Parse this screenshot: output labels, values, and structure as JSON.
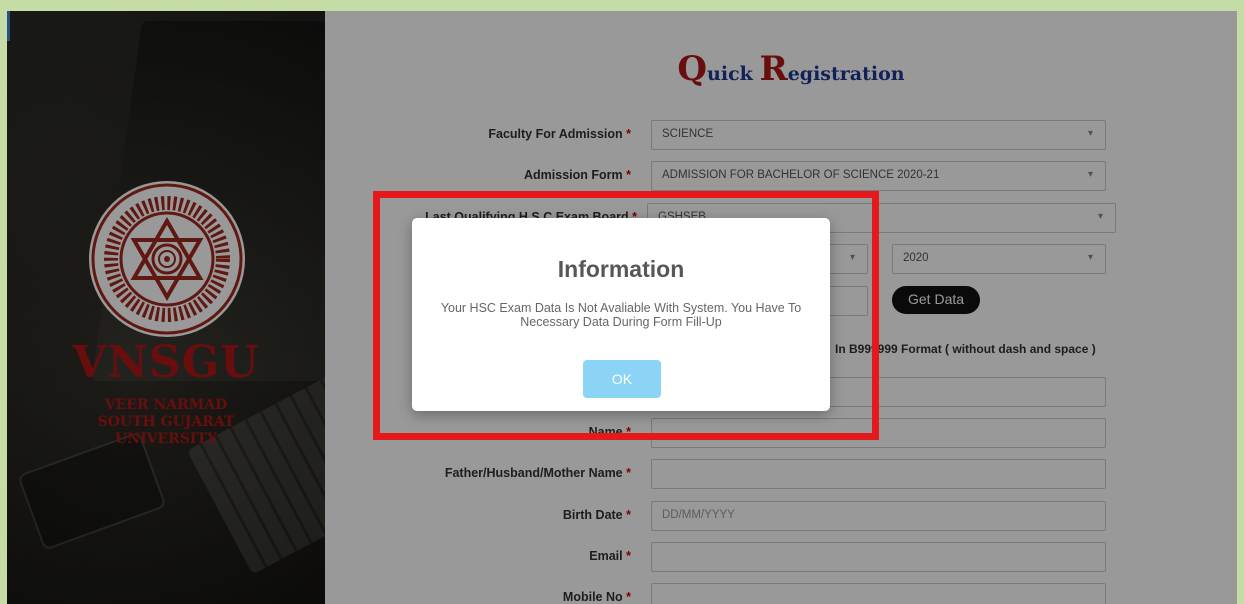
{
  "brand": {
    "short": "VNSGU",
    "line1": "VEER NARMAD",
    "line2": "SOUTH GUJARAT",
    "line3": "UNIVERSITY"
  },
  "title": {
    "q": "Q",
    "uick": "uick ",
    "r": "R",
    "egistration": "egistration"
  },
  "form": {
    "faculty_label": "Faculty For Admission",
    "faculty_value": "SCIENCE",
    "admission_form_label": "Admission Form",
    "admission_form_value": "ADMISSION FOR BACHELOR OF SCIENCE 2020-21",
    "board_label": "Last Qualifying H.S.C Exam Board",
    "board_value": "GSHSEB",
    "year_value": "2020",
    "get_data_label": "Get Data",
    "seat_hint": "In B999999 Format ( without dash and space )",
    "name_label": "Name",
    "parent_label": "Father/Husband/Mother Name",
    "birth_label": "Birth Date",
    "birth_placeholder": "DD/MM/YYYY",
    "email_label": "Email",
    "mobile_label": "Mobile No",
    "required_mark": "*"
  },
  "modal": {
    "title": "Information",
    "message": "Your HSC Exam Data Is Not Avaliable With System. You Have To Necessary Data During Form Fill-Up",
    "ok_label": "OK"
  },
  "colors": {
    "accent_red": "#b01818",
    "highlight": "#e5181c",
    "ok_button": "#8cd4f5",
    "background": "#c5dca6"
  }
}
